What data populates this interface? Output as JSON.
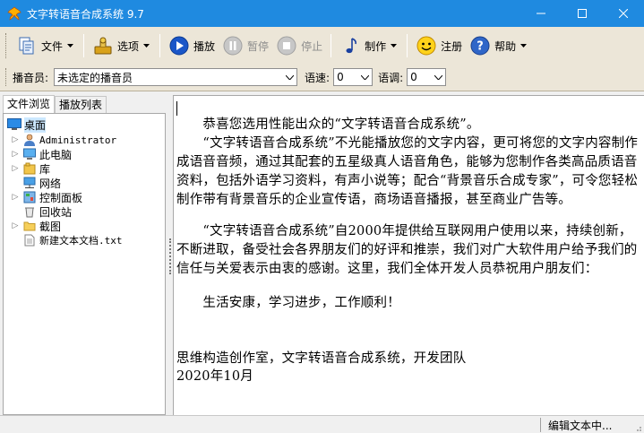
{
  "window": {
    "title": "文字转语音合成系统 9.7",
    "accent": "#1f8ae0"
  },
  "toolbar": {
    "file_label": "文件",
    "options_label": "选项",
    "play_label": "播放",
    "pause_label": "暂停",
    "stop_label": "停止",
    "make_label": "制作",
    "register_label": "注册",
    "help_label": "帮助"
  },
  "options": {
    "voice_label": "播音员:",
    "voice_value": "未选定的播音员",
    "speed_label": "语速:",
    "speed_value": "0",
    "pitch_label": "语调:",
    "pitch_value": "0"
  },
  "tabs": {
    "browse": "文件浏览",
    "playlist": "播放列表"
  },
  "tree": {
    "root": "桌面",
    "items": [
      {
        "label": "Administrator",
        "icon": "user-icon"
      },
      {
        "label": "此电脑",
        "icon": "computer-icon"
      },
      {
        "label": "库",
        "icon": "library-icon"
      },
      {
        "label": "网络",
        "icon": "network-icon"
      },
      {
        "label": "控制面板",
        "icon": "control-panel-icon"
      },
      {
        "label": "回收站",
        "icon": "recycle-bin-icon"
      },
      {
        "label": "截图",
        "icon": "folder-icon"
      },
      {
        "label": "新建文本文档.txt",
        "icon": "text-file-icon"
      }
    ]
  },
  "editor": {
    "p1": "　　恭喜您选用性能出众的“文字转语音合成系统”。",
    "p2": "　　“文字转语音合成系统”不光能播放您的文字内容，更可将您的文字内容制作成语音音频，通过其配套的五星级真人语音角色，能够为您制作各类高品质语音资料，包括外语学习资料，有声小说等；配合“背景音乐合成专家”，可令您轻松制作带有背景音乐的企业宣传语，商场语音播报，甚至商业广告等。",
    "p3": "　　“文字转语音合成系统”自2000年提供给互联网用户使用以来，持续创新，不断进取，备受社会各界朋友们的好评和推崇，我们对广大软件用户给予我们的信任与关爱表示由衷的感谢。这里，我们全体开发人员恭祝用户朋友们：",
    "p4": "　　生活安康，学习进步，工作顺利！",
    "p5": "思维构造创作室，文字转语音合成系统，开发团队",
    "p6": "2020年10月"
  },
  "status": {
    "text": "编辑文本中..."
  }
}
